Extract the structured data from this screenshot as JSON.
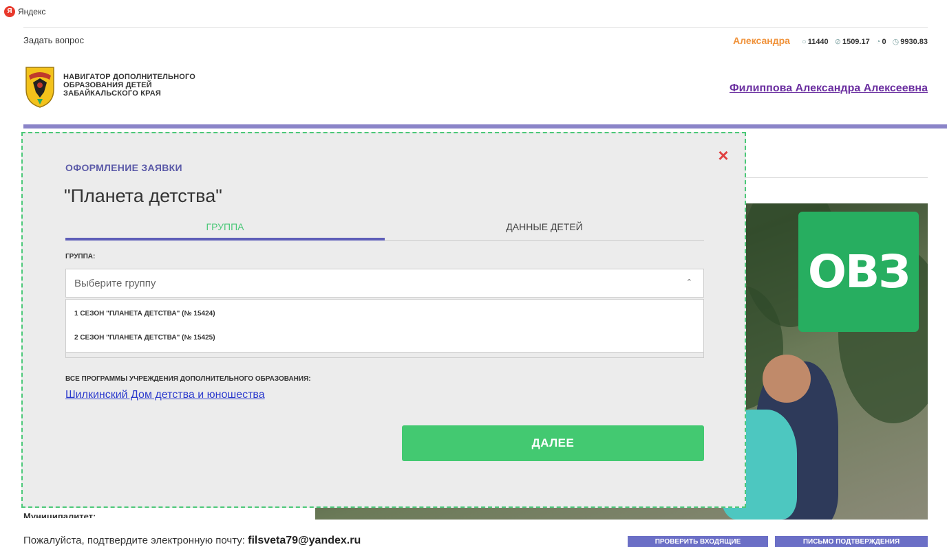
{
  "browser": {
    "logo": "Я",
    "title": "Яндекс"
  },
  "topbar": {
    "ask": "Задать вопрос",
    "user_name": "Александра",
    "stats": [
      {
        "icon": "○",
        "value": "11440"
      },
      {
        "icon": "⊘",
        "value": "1509.17"
      },
      {
        "icon": "◔",
        "value": "0"
      },
      {
        "icon": "◷",
        "value": "9930.83"
      }
    ]
  },
  "header": {
    "site_title_line1": "НАВИГАТОР ДОПОЛНИТЕЛЬНОГО",
    "site_title_line2": "ОБРАЗОВАНИЯ ДЕТЕЙ",
    "site_title_line3": "ЗАБАЙКАЛЬСКОГО КРАЯ",
    "profile_name": "Филиппова Александра Алексеевна"
  },
  "background": {
    "badge": "ОВЗ",
    "cut_text": "Муниципалитет:"
  },
  "modal": {
    "close_icon": "×",
    "kicker": "ОФОРМЛЕНИЕ ЗАЯВКИ",
    "title": "\"Планета детства\"",
    "tabs": [
      {
        "label": "ГРУППА",
        "active": true
      },
      {
        "label": "ДАННЫЕ ДЕТЕЙ",
        "active": false
      }
    ],
    "group_label": "ГРУППА:",
    "select_placeholder": "Выберите группу",
    "select_chevron": "⌃",
    "options": [
      "1 СЕЗОН \"ПЛАНЕТА ДЕТСТВА\" (№ 15424)",
      "2 СЕЗОН \"ПЛАНЕТА ДЕТСТВА\" (№ 15425)"
    ],
    "all_programs_label": "ВСЕ ПРОГРАММЫ УЧРЕЖДЕНИЯ ДОПОЛНИТЕЛЬНОГО ОБРАЗОВАНИЯ:",
    "org_link": "Шилкинский Дом детства и юношества",
    "next_button": "ДАЛЕЕ"
  },
  "bottom": {
    "confirm_text": "Пожалуйста, подтвердите электронную почту: ",
    "email": "filsveta79@yandex.ru",
    "check_button": "ПРОВЕРИТЬ ВХОДЯЩИЕ",
    "letter_button": "ПИСЬМО ПОДТВЕРЖДЕНИЯ"
  },
  "colors": {
    "accent_purple": "#5e5eb8",
    "green": "#43c971",
    "close_red": "#e04040",
    "user_orange": "#f0923a"
  }
}
